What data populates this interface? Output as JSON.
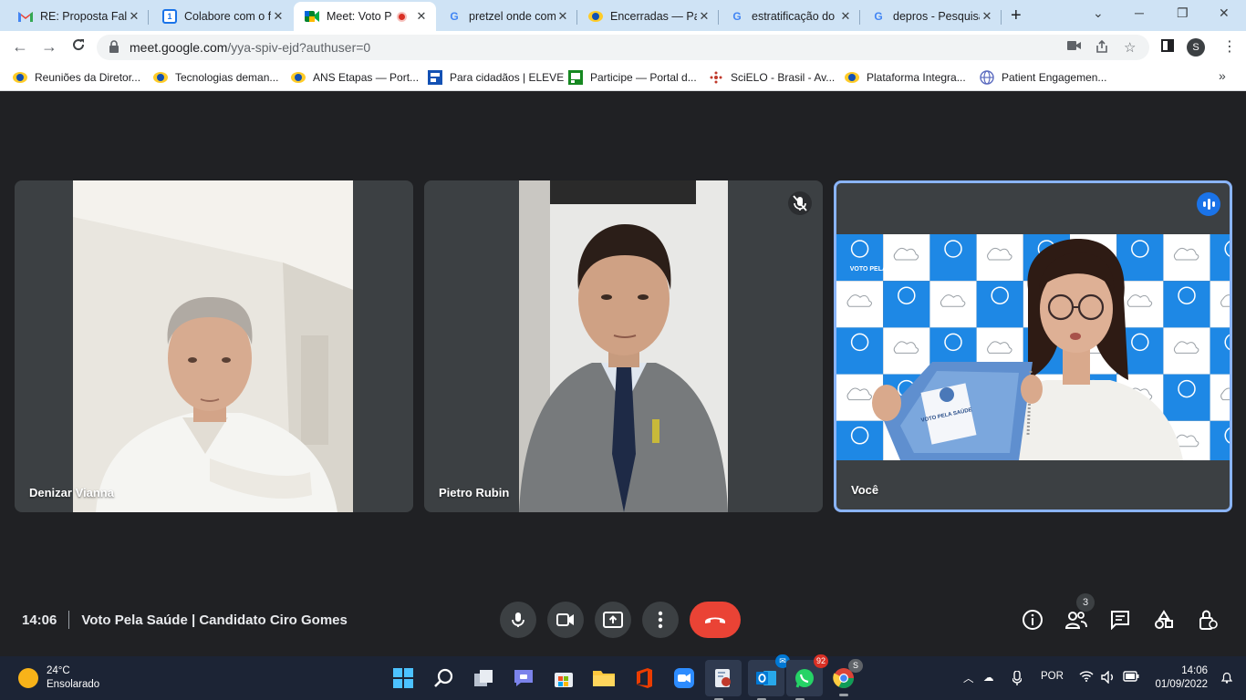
{
  "browser": {
    "tabs": [
      {
        "title": "RE: Proposta Falc",
        "favicon": "gmail-icon"
      },
      {
        "title": "Colabore com o f",
        "favicon": "calendar-icon"
      },
      {
        "title": "Meet: Voto P",
        "favicon": "meet-icon",
        "active": true,
        "recording": true
      },
      {
        "title": "pretzel onde com",
        "favicon": "google-icon"
      },
      {
        "title": "Encerradas — Pa",
        "favicon": "gov-br-icon"
      },
      {
        "title": "estratificação do",
        "favicon": "google-icon"
      },
      {
        "title": "depros - Pesquisa",
        "favicon": "google-icon"
      }
    ],
    "close_glyph": "✕",
    "new_tab_glyph": "+",
    "address": {
      "host": "meet.google.com",
      "path": "/yya-spiv-ejd?authuser=0"
    },
    "profile_initial": "S",
    "bookmarks": [
      {
        "label": "Reuniões da Diretor...",
        "icon": "gov-br-icon"
      },
      {
        "label": "Tecnologias deman...",
        "icon": "gov-br-icon"
      },
      {
        "label": "ANS Etapas — Port...",
        "icon": "gov-br-icon"
      },
      {
        "label": "Para cidadãos | ELEVE",
        "icon": "eleve-icon"
      },
      {
        "label": "Participe — Portal d...",
        "icon": "participe-icon"
      },
      {
        "label": "SciELO - Brasil - Av...",
        "icon": "scielo-icon"
      },
      {
        "label": "Plataforma Integra...",
        "icon": "gov-br-icon"
      },
      {
        "label": "Patient Engagemen...",
        "icon": "globe-icon"
      }
    ],
    "bookmarks_more": "»"
  },
  "meet": {
    "participants": [
      {
        "name": "Denizar Vianna"
      },
      {
        "name": "Pietro Rubin",
        "muted": true
      },
      {
        "name": "Você",
        "speaking": true
      }
    ],
    "time": "14:06",
    "meeting_title": "Voto Pela Saúde | Candidato Ciro Gomes",
    "people_count": "3",
    "backdrop_logo_text": "VOTO PELA SAÚDE",
    "document_text": "VOTO PELA SAÚDE"
  },
  "taskbar": {
    "weather": {
      "temp": "24°C",
      "desc": "Ensolarado"
    },
    "whatsapp_badge": "92",
    "chrome_profile": "S",
    "language": "POR",
    "time": "14:06",
    "date": "01/09/2022"
  },
  "colors": {
    "meet_bg": "#202124",
    "tile_bg": "#3c4043",
    "end_call": "#ea4335",
    "speaking_blue": "#1a73e8",
    "tab_strip": "#cfe3f5",
    "taskbar": "#1c2435"
  }
}
